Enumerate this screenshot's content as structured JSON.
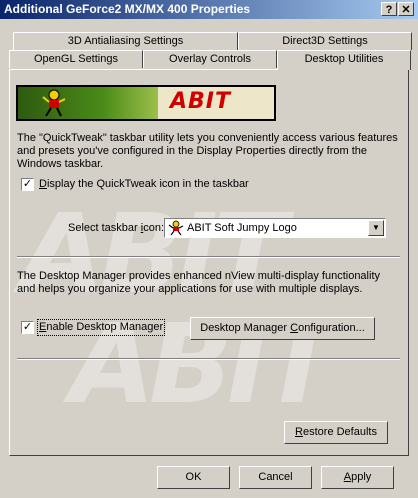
{
  "window": {
    "title": "Additional GeForce2 MX/MX 400 Properties",
    "help_label": "?",
    "close_label": "✕"
  },
  "tabs": {
    "row1": [
      "3D Antialiasing Settings",
      "Direct3D Settings"
    ],
    "row2": [
      "OpenGL Settings",
      "Overlay Controls",
      "Desktop Utilities"
    ],
    "active": "Desktop Utilities"
  },
  "banner": {
    "logo_text": "ABIT",
    "logo_color": "#d00000",
    "watermark_text": "ABIT"
  },
  "quicktweak": {
    "description": "The \"QuickTweak\" taskbar utility lets you conveniently access various features and presets you've configured in the Display Properties directly from the Windows taskbar.",
    "checkbox_label_pre": "D",
    "checkbox_label_post": "isplay the QuickTweak icon in the taskbar",
    "checked": true,
    "select_label_pre": "Select taskbar ",
    "select_label_ul": "i",
    "select_label_post": "con:",
    "select_value": "ABIT Soft Jumpy Logo",
    "select_icon": "jumpy-figure-icon"
  },
  "desktop_manager": {
    "description": "The Desktop Manager provides enhanced nView multi-display functionality and helps you organize your applications for use with multiple displays.",
    "checkbox_label_pre": "E",
    "checkbox_label_post": "nable Desktop Manager",
    "checked": true,
    "config_pre": "Desktop Manager ",
    "config_ul": "C",
    "config_post": "onfiguration..."
  },
  "restore": {
    "pre": "",
    "ul": "R",
    "post": "estore Defaults"
  },
  "footer": {
    "ok_label": "OK",
    "cancel_label": "Cancel",
    "apply_ul": "A",
    "apply_post": "pply"
  },
  "colors": {
    "titlebar_start": "#0a246a",
    "titlebar_end": "#a6caf0",
    "face": "#d4d0c8"
  }
}
